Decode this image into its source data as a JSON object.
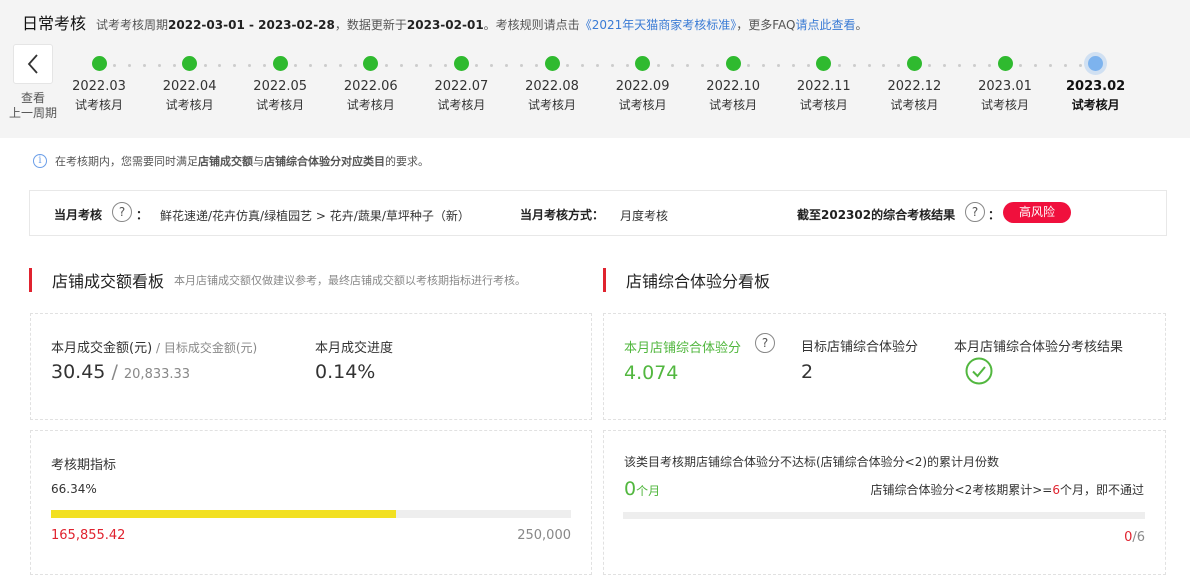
{
  "header": {
    "title": "日常考核",
    "desc_prefix": "试考考核周期",
    "period": "2022-03-01 - 2023-02-28",
    "desc_mid": "，数据更新于",
    "updated": "2023-02-01",
    "desc_rule": "。考核规则请点击",
    "rule_link": "《2021年天猫商家考核标准》",
    "desc_faq": "，更多FAQ",
    "faq_link": "请点此查看",
    "desc_end": "。"
  },
  "timeline": {
    "prev_label_1": "查看",
    "prev_label_2": "上一周期",
    "items": [
      {
        "ym": "2022.03",
        "label": "试考核月"
      },
      {
        "ym": "2022.04",
        "label": "试考核月"
      },
      {
        "ym": "2022.05",
        "label": "试考核月"
      },
      {
        "ym": "2022.06",
        "label": "试考核月"
      },
      {
        "ym": "2022.07",
        "label": "试考核月"
      },
      {
        "ym": "2022.08",
        "label": "试考核月"
      },
      {
        "ym": "2022.09",
        "label": "试考核月"
      },
      {
        "ym": "2022.10",
        "label": "试考核月"
      },
      {
        "ym": "2022.11",
        "label": "试考核月"
      },
      {
        "ym": "2022.12",
        "label": "试考核月"
      },
      {
        "ym": "2023.01",
        "label": "试考核月"
      },
      {
        "ym": "2023.02",
        "label": "试考核月"
      }
    ],
    "current_index": 11
  },
  "tip": {
    "pre": "在考核期内，您需要同时满足",
    "b1": "店铺成交额",
    "mid": "与",
    "b2": "店铺综合体验分对应类目",
    "end": "的要求。"
  },
  "summary": {
    "month_key": "当月考核",
    "category": "鲜花速递/花卉仿真/绿植园艺 > 花卉/蔬果/草坪种子（新）",
    "method_key": "当月考核方式：",
    "method_value": "月度考核",
    "result_key": "截至202302的综合考核结果",
    "result_value": "高风险",
    "q_glyph": "?",
    "colon": "："
  },
  "left_section": {
    "title": "店铺成交额看板",
    "subtitle": "本月店铺成交额仅做建议参考，最终店铺成交额以考核期指标进行考核。",
    "card1": {
      "amount_label": "本月成交金额(元)",
      "target_label": " / 目标成交金额(元)",
      "amount": "30.45",
      "slash": " / ",
      "target": "20,833.33",
      "progress_label": "本月成交进度",
      "progress_value": "0.14%"
    },
    "card2": {
      "label": "考核期指标",
      "pct": "66.34%",
      "fill_fraction": 0.6634,
      "current": "165,855.42",
      "target": "250,000"
    }
  },
  "right_section": {
    "title": "店铺综合体验分看板",
    "card1": {
      "score_label": "本月店铺综合体验分",
      "score": "4.074",
      "target_label": "目标店铺综合体验分",
      "target": "2",
      "result_label": "本月店铺综合体验分考核结果"
    },
    "card2": {
      "title": "该类目考核期店铺综合体验分不达标(店铺综合体验分<2)的累计月份数",
      "count": "0",
      "count_unit": "个月",
      "rule_pre": "店铺综合体验分<2考核期累计>=",
      "rule_num": "6",
      "rule_post": "个月，即不通过",
      "fraction_num": "0",
      "fraction_den": "/6"
    }
  },
  "colors": {
    "green": "#2fba2f",
    "current_dot": "#7db3ee",
    "risk_red": "#f0103d",
    "progress_yellow": "#f2e022",
    "accent_red": "#e0232f",
    "link_blue": "#3a7bd5"
  }
}
